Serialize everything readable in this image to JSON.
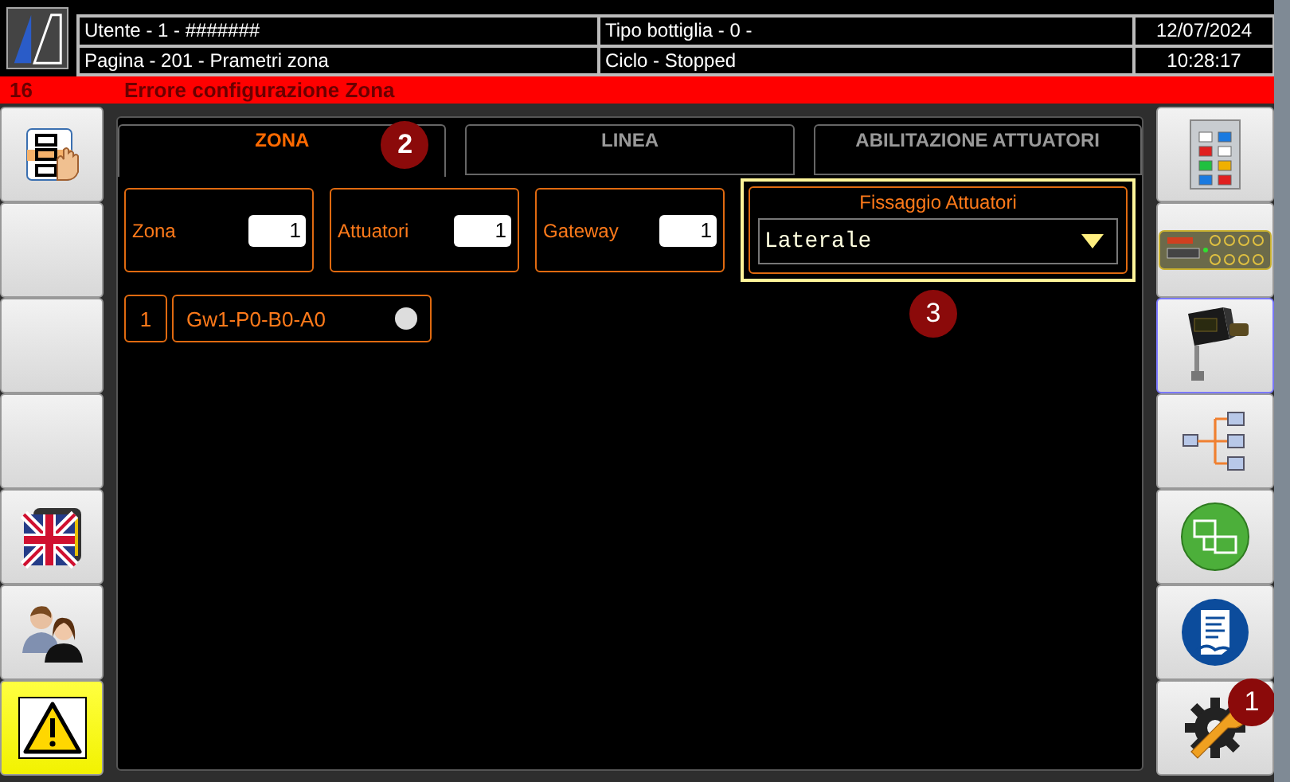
{
  "header": {
    "user": "Utente - 1 - #######",
    "bottle": "Tipo bottiglia - 0 -",
    "date": "12/07/2024",
    "page": "Pagina - 201 - Prametri zona",
    "cycle": "Ciclo - Stopped",
    "time": "10:28:17"
  },
  "alarm": {
    "code": "16",
    "message": "Errore configurazione Zona"
  },
  "left_buttons": [
    {
      "kind": "hand-diagram",
      "active": false
    },
    {
      "kind": "blank",
      "active": false
    },
    {
      "kind": "blank",
      "active": false
    },
    {
      "kind": "blank",
      "active": false
    },
    {
      "kind": "flags",
      "active": false
    },
    {
      "kind": "users",
      "active": false
    },
    {
      "kind": "warning",
      "active": true
    }
  ],
  "tabs": [
    {
      "label": "ZONA",
      "selected": true,
      "callout": "2"
    },
    {
      "label": "LINEA",
      "selected": false
    },
    {
      "label": "ABILITAZIONE ATTUATORI",
      "selected": false
    }
  ],
  "fields": [
    {
      "label": "Zona",
      "value": "1"
    },
    {
      "label": "Attuatori",
      "value": "1"
    },
    {
      "label": "Gateway",
      "value": "1"
    }
  ],
  "fixing": {
    "title": "Fissaggio Attuatori",
    "value": "Laterale",
    "highlighted": true,
    "callout": "3"
  },
  "gateways": [
    {
      "index": "1",
      "name": "Gw1-P0-B0-A0",
      "online": false
    }
  ],
  "right_buttons": [
    {
      "kind": "panel",
      "selected": false
    },
    {
      "kind": "module",
      "selected": false
    },
    {
      "kind": "actuator",
      "selected": true
    },
    {
      "kind": "tree",
      "selected": false
    },
    {
      "kind": "network",
      "selected": false
    },
    {
      "kind": "document",
      "selected": false
    },
    {
      "kind": "settings",
      "selected": false,
      "callout": "1"
    }
  ]
}
